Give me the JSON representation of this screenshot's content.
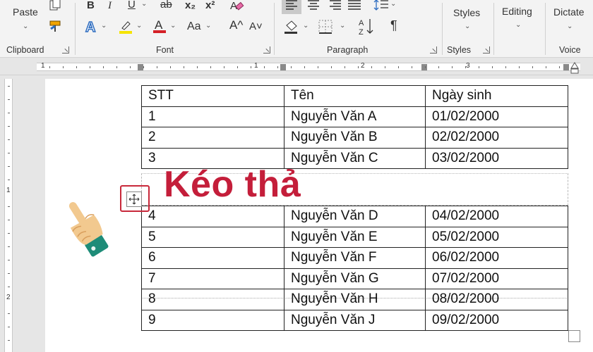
{
  "ribbon": {
    "clipboard": {
      "paste_label": "Paste",
      "group_label": "Clipboard"
    },
    "font": {
      "group_label": "Font",
      "bold": "B",
      "italic": "I",
      "underline": "U",
      "strike": "ab",
      "subscript": "x₂",
      "superscript": "x²",
      "change_case": "Aa",
      "grow": "A^",
      "shrink": "A˅"
    },
    "paragraph": {
      "group_label": "Paragraph",
      "sort": "A↓Z",
      "pilcrow": "¶"
    },
    "styles": {
      "button_label": "Styles",
      "group_label": "Styles"
    },
    "editing": {
      "button_label": "Editing"
    },
    "voice": {
      "button_label": "Dictate",
      "group_label": "Voice"
    },
    "colors": {
      "highlight": "#f5e400",
      "font_color": "#d42027",
      "text_effect": "#2d6cc0"
    }
  },
  "ruler": {
    "h_numbers": [
      "1",
      "1",
      "2",
      "3"
    ],
    "v_numbers": [
      "1",
      "2"
    ]
  },
  "table": {
    "header": [
      "STT",
      "Tên",
      "Ngày sinh"
    ],
    "rows_top": [
      [
        "1",
        "Nguyễn Văn A",
        "01/02/2000"
      ],
      [
        "2",
        "Nguyễn Văn B",
        "02/02/2000"
      ],
      [
        "3",
        "Nguyễn Văn C",
        "03/02/2000"
      ]
    ],
    "rows_bottom": [
      [
        "4",
        "Nguyễn Văn D",
        "04/02/2000"
      ],
      [
        "5",
        "Nguyễn Văn E",
        "05/02/2000"
      ],
      [
        "6",
        "Nguyễn Văn F",
        "06/02/2000"
      ],
      [
        "7",
        "Nguyễn Văn G",
        "07/02/2000"
      ],
      [
        "8",
        "Nguyễn Văn H",
        "08/02/2000"
      ],
      [
        "9",
        "Nguyễn Văn J",
        "09/02/2000"
      ]
    ]
  },
  "overlay": {
    "caption": "Kéo thả",
    "caption_color": "#c41e3a",
    "move_handle_icon": "move-icon",
    "pointer_icon": "pointing-hand-icon"
  }
}
